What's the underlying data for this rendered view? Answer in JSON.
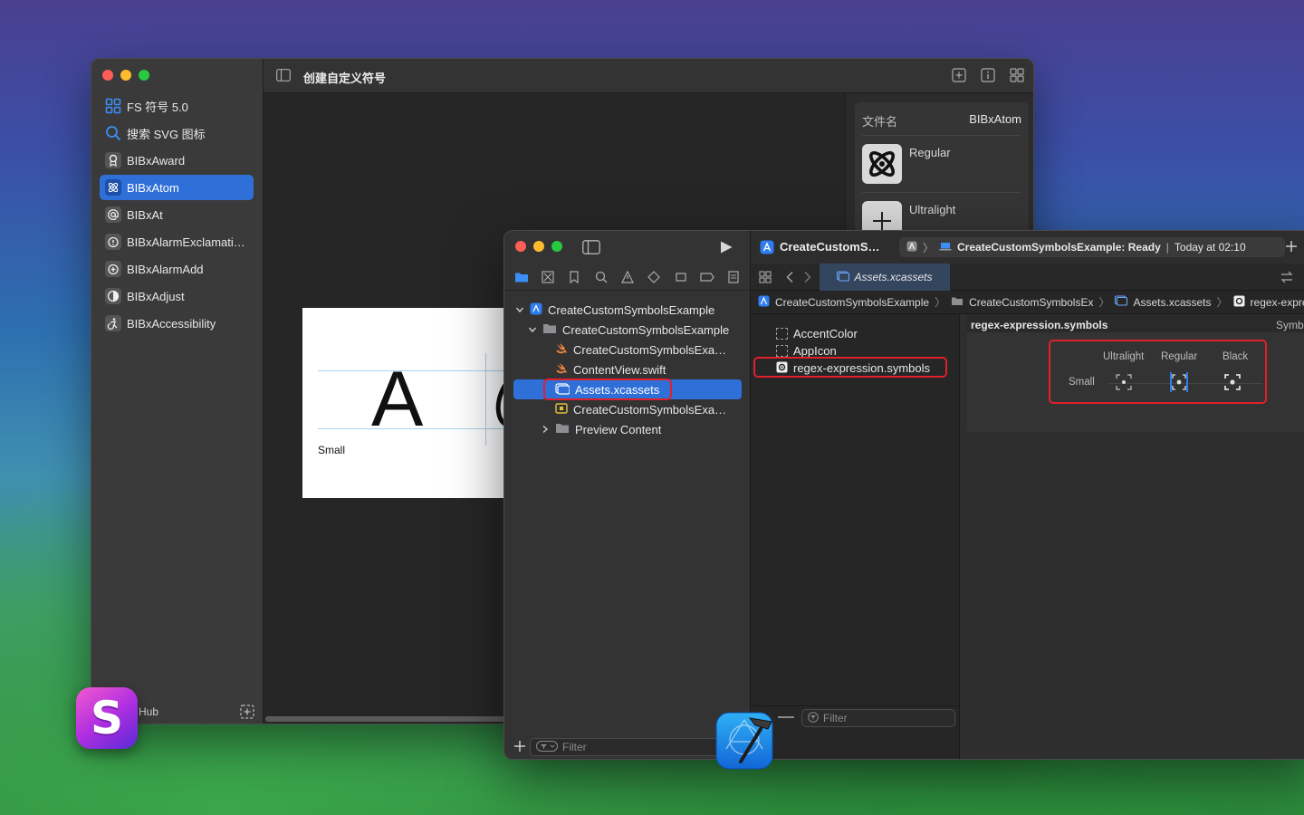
{
  "fs_window": {
    "title": "创建自定义符号",
    "sidebar": {
      "items": [
        {
          "label": "FS 符号 5.0",
          "icon": "grid-icon"
        },
        {
          "label": "搜索 SVG 图标",
          "icon": "search-icon"
        },
        {
          "label": "BIBxAward",
          "icon": "award-icon"
        },
        {
          "label": "BIBxAtom",
          "icon": "atom-icon",
          "active": true
        },
        {
          "label": "BIBxAt",
          "icon": "at-icon"
        },
        {
          "label": "BIBxAlarmExclamati…",
          "icon": "alarm-exclamation-icon"
        },
        {
          "label": "BIBxAlarmAdd",
          "icon": "alarm-add-icon"
        },
        {
          "label": "BIBxAdjust",
          "icon": "adjust-icon"
        },
        {
          "label": "BIBxAccessibility",
          "icon": "accessibility-icon"
        }
      ],
      "footer_label": "Hub"
    },
    "preview": {
      "glyph": "A",
      "size_label": "Small"
    },
    "inspector": {
      "filename_label": "文件名",
      "filename_value": "BIBxAtom",
      "weights": [
        "Regular",
        "Ultralight"
      ]
    }
  },
  "xcode_window": {
    "scheme": "CreateCustomS…",
    "status": "CreateCustomSymbolsExample: Ready",
    "status_time": "Today at 02:10",
    "tab": "Assets.xcassets",
    "navigator": {
      "tree": [
        {
          "label": "CreateCustomSymbolsExample",
          "level": 0,
          "kind": "project",
          "expanded": true
        },
        {
          "label": "CreateCustomSymbolsExample",
          "level": 1,
          "kind": "folder",
          "expanded": true
        },
        {
          "label": "CreateCustomSymbolsExa…",
          "level": 2,
          "kind": "swift"
        },
        {
          "label": "ContentView.swift",
          "level": 2,
          "kind": "swift"
        },
        {
          "label": "Assets.xcassets",
          "level": 2,
          "kind": "assets",
          "selected": true
        },
        {
          "label": "CreateCustomSymbolsExa…",
          "level": 2,
          "kind": "entitlements"
        },
        {
          "label": "Preview Content",
          "level": 2,
          "kind": "folder",
          "expanded": false
        }
      ],
      "filter_placeholder": "Filter"
    },
    "jump_bar": [
      "CreateCustomSymbolsExample",
      "CreateCustomSymbolsEx",
      "Assets.xcassets",
      "regex-expression.s"
    ],
    "assets": {
      "items": [
        "AccentColor",
        "AppIcon",
        "regex-expression.symbols"
      ],
      "filter_placeholder": "Filter"
    },
    "symbol_detail": {
      "name": "regex-expression.symbols",
      "right_label": "Symbo",
      "weights": [
        "Ultralight",
        "Regular",
        "Black"
      ],
      "scale": "Small"
    }
  },
  "dock": {
    "s_app_letter": "S"
  }
}
